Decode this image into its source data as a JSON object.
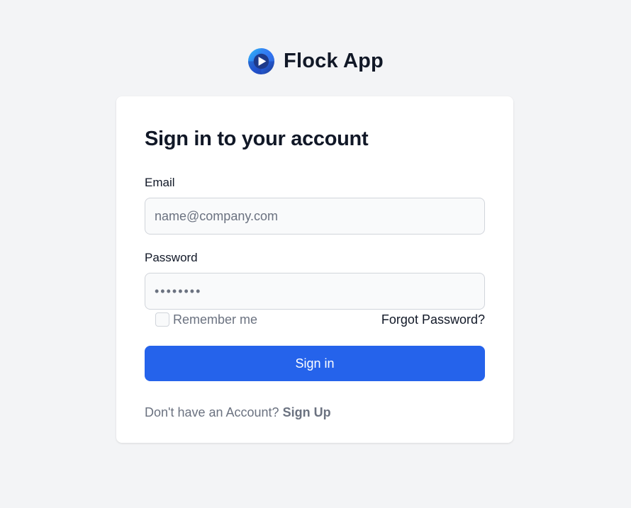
{
  "app": {
    "name": "Flock App",
    "logo_icon": "play-circle-logo-icon",
    "brand_colors": [
      "#1e40af",
      "#2563eb",
      "#38bdf8"
    ]
  },
  "login": {
    "title": "Sign in to your account",
    "email": {
      "label": "Email",
      "placeholder": "name@company.com",
      "value": ""
    },
    "password": {
      "label": "Password",
      "masked_value": "••••••••"
    },
    "remember_me": {
      "label": "Remember me",
      "checked": false
    },
    "forgot_password": "Forgot Password?",
    "submit_label": "Sign in",
    "signup_prompt": "Don't have an Account?",
    "signup_link": "Sign Up"
  },
  "colors": {
    "primary": "#2563eb",
    "background": "#f3f4f6",
    "card": "#ffffff",
    "input_bg": "#f9fafb",
    "border": "#d1d5db",
    "text_dark": "#111827",
    "text_muted": "#6b7280"
  }
}
